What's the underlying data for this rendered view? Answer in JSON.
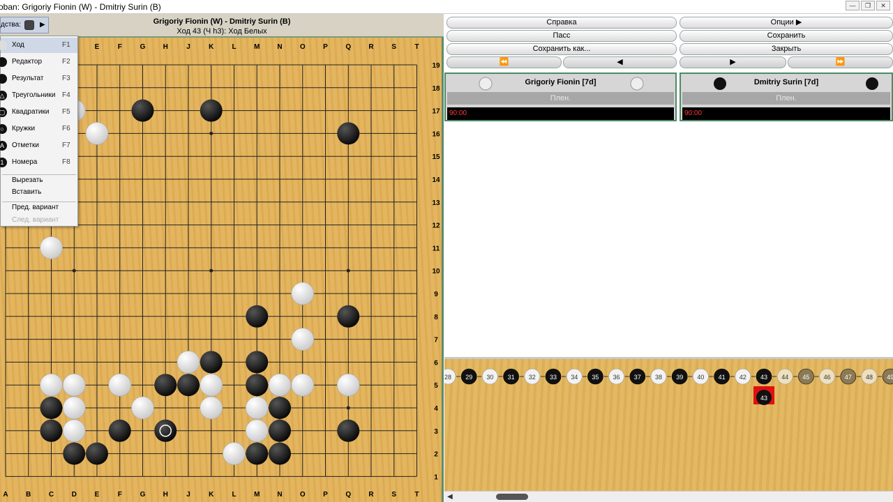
{
  "window": {
    "title": "oban: Grigoriy Fionin (W) - Dmitriy Surin (B)",
    "controls": [
      "—",
      "❐",
      "✕"
    ]
  },
  "toolbar": {
    "tools_label": "дства:"
  },
  "board_header": {
    "title": "Grigoriy Fionin (W) - Dmitriy Surin (B)",
    "subtitle": "Ход 43 (Ч h3): Ход Белых"
  },
  "board": {
    "columns": [
      "A",
      "B",
      "C",
      "D",
      "E",
      "F",
      "G",
      "H",
      "J",
      "K",
      "L",
      "M",
      "N",
      "O",
      "P",
      "Q",
      "R",
      "S",
      "T"
    ],
    "rows": [
      "19",
      "18",
      "17",
      "16",
      "15",
      "14",
      "13",
      "12",
      "11",
      "10",
      "9",
      "8",
      "7",
      "6",
      "5",
      "4",
      "3",
      "2",
      "1"
    ],
    "black_stones": [
      "G17",
      "K17",
      "Q16",
      "M8",
      "Q8",
      "K6",
      "M6",
      "H5",
      "J5",
      "M5",
      "C4",
      "N4",
      "C3",
      "F3",
      "H3",
      "N3",
      "Q3",
      "D2",
      "E2",
      "M2",
      "N2"
    ],
    "white_stones": [
      "D17",
      "E16",
      "C11",
      "O9",
      "O7",
      "J6",
      "C5",
      "D5",
      "F5",
      "K5",
      "N5",
      "O5",
      "Q5",
      "D4",
      "G4",
      "K4",
      "M4",
      "D3",
      "M3",
      "L2"
    ],
    "last_move": "H3"
  },
  "menu": {
    "items": [
      {
        "label": "Ход",
        "key": "F1",
        "icon": "white-stone-icon",
        "selected": true
      },
      {
        "label": "Редактор",
        "key": "F2",
        "icon": "editor-stones-icon"
      },
      {
        "label": "Результат",
        "key": "F3",
        "icon": "result-icon"
      },
      {
        "label": "Треугольники",
        "key": "F4",
        "icon": "triangle-icon"
      },
      {
        "label": "Квадратики",
        "key": "F5",
        "icon": "square-icon"
      },
      {
        "label": "Кружки",
        "key": "F6",
        "icon": "circle-icon"
      },
      {
        "label": "Отметки",
        "key": "F7",
        "icon": "A"
      },
      {
        "label": "Номера",
        "key": "F8",
        "icon": "1"
      }
    ],
    "edit_items": [
      "Вырезать",
      "Вставить"
    ],
    "variant_items": [
      {
        "label": "Пред. вариант",
        "enabled": true
      },
      {
        "label": "След. вариант",
        "enabled": false
      }
    ]
  },
  "controls": {
    "help": "Справка",
    "options": "Опции",
    "pass": "Пасс",
    "save": "Сохранить",
    "save_as": "Сохранить как...",
    "close": "Закрыть",
    "nav": [
      "⏪",
      "◀",
      "▶",
      "⏩"
    ]
  },
  "players": {
    "white": {
      "name": "Grigoriy Fionin  [7d]",
      "captures": "Плен.",
      "time": "90:00"
    },
    "black": {
      "name": "Dmitriy Surin [7d]",
      "captures": "Плен.",
      "time": "90:00"
    }
  },
  "tree": {
    "main_line": [
      "28",
      "29",
      "30",
      "31",
      "32",
      "33",
      "34",
      "35",
      "36",
      "37",
      "38",
      "39",
      "40",
      "41",
      "42",
      "43",
      "44",
      "45",
      "46",
      "47",
      "48",
      "49"
    ],
    "current": "43"
  },
  "colors": {
    "board": "#e2b25a",
    "panel_border": "#4f8a67",
    "time_text": "#ff3b3b",
    "current_node": "#e01010"
  }
}
